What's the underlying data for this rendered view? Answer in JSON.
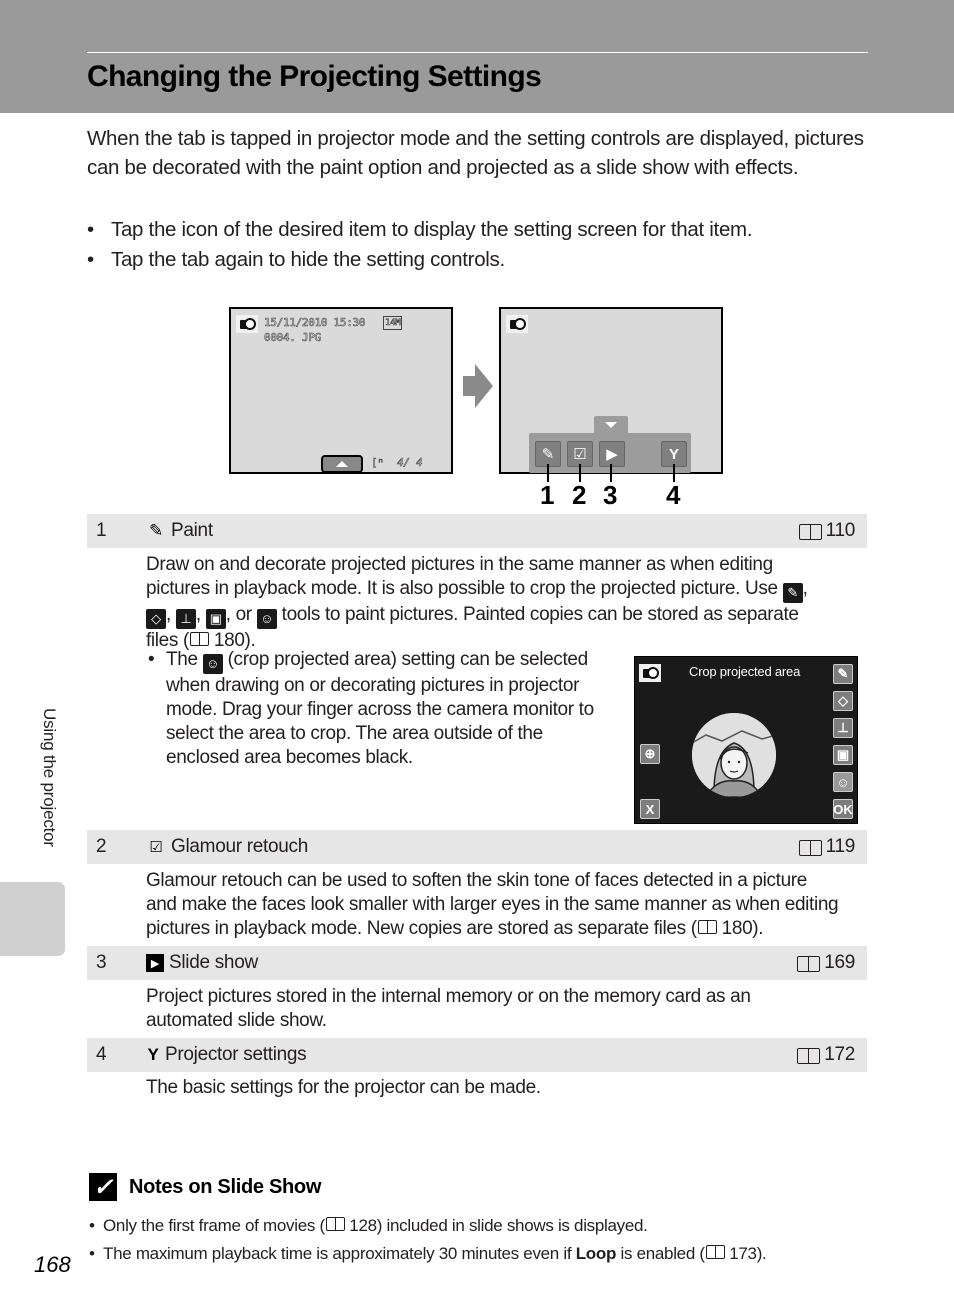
{
  "page": {
    "title": "Changing the Projecting Settings",
    "section_tab_label": "Using the projector",
    "page_number": "168"
  },
  "intro": {
    "paragraph": "When the tab is tapped in projector mode and the setting controls are displayed, pictures can be decorated with the paint option and projected as a slide show with effects.",
    "bullets": [
      "Tap the icon of the desired item to display the setting screen for that item.",
      "Tap the tab again to hide the setting controls."
    ]
  },
  "figure": {
    "screen_before": {
      "datetime": "15/11/2010  15:30",
      "image_size_icon": "14M",
      "filename": "0004. JPG",
      "frame_counter": "4/    4",
      "icons": [
        "projector-icon",
        "tab-up-arrow-icon",
        "memory-icon"
      ]
    },
    "screen_after": {
      "controls": [
        {
          "callout": "1",
          "icon": "paint-icon",
          "glyph": "✎"
        },
        {
          "callout": "2",
          "icon": "glamour-retouch-icon",
          "glyph": "☑"
        },
        {
          "callout": "3",
          "icon": "slide-show-icon",
          "glyph": "▶"
        },
        {
          "callout": "4",
          "icon": "projector-settings-icon",
          "glyph": "Y"
        }
      ]
    },
    "callouts": [
      "1",
      "2",
      "3",
      "4"
    ]
  },
  "items": [
    {
      "number": "1",
      "title": "Paint",
      "icon": "paint-icon",
      "ref_page": "110",
      "body_lines": [
        "Draw on and decorate projected pictures in the same manner as when editing",
        "pictures in playback mode. It is also possible to crop the projected picture. Use",
        "tools to paint pictures. Painted copies can be stored as separate",
        "files (",
        "180)."
      ],
      "body_sep": [
        ",",
        ", or"
      ],
      "sub_bullet": {
        "prefix": "The",
        "text": "(crop projected area) setting can be selected when drawing on or decorating pictures in projector mode. Drag your finger across the camera monitor to select the area to crop. The area outside of the enclosed area becomes black."
      },
      "crop_screen": {
        "title": "Crop projected area",
        "right_tools": [
          "pencil-icon",
          "eraser-icon",
          "stamp-icon",
          "frame-icon",
          "crop-icon"
        ],
        "left_tools": [
          "zoom-in-icon"
        ],
        "cancel_label": "X",
        "ok_label": "OK"
      }
    },
    {
      "number": "2",
      "title": "Glamour retouch",
      "icon": "glamour-retouch-icon",
      "ref_page": "119",
      "body_lines": [
        "Glamour retouch can be used to soften the skin tone of faces detected in a picture",
        "and make the faces look smaller with larger eyes in the same manner as when editing",
        "pictures in playback mode. New copies are stored as separate files (",
        "180)."
      ]
    },
    {
      "number": "3",
      "title": "Slide show",
      "icon": "slide-show-icon",
      "ref_page": "169",
      "body_lines": [
        "Project pictures stored in the internal memory or on the memory card as an",
        "automated slide show."
      ]
    },
    {
      "number": "4",
      "title": "Projector settings",
      "icon": "projector-settings-icon",
      "ref_page": "172",
      "body_lines": [
        "The basic settings for the projector can be made."
      ]
    }
  ],
  "notes": {
    "title": "Notes on Slide Show",
    "items": [
      {
        "before": "Only the first frame of movies (",
        "ref": "128",
        "after": ") included in slide shows is displayed."
      },
      {
        "before": "The maximum playback time is approximately 30 minutes even if ",
        "bold": "Loop",
        "middle": " is enabled (",
        "ref": "173",
        "after": ")."
      }
    ]
  }
}
